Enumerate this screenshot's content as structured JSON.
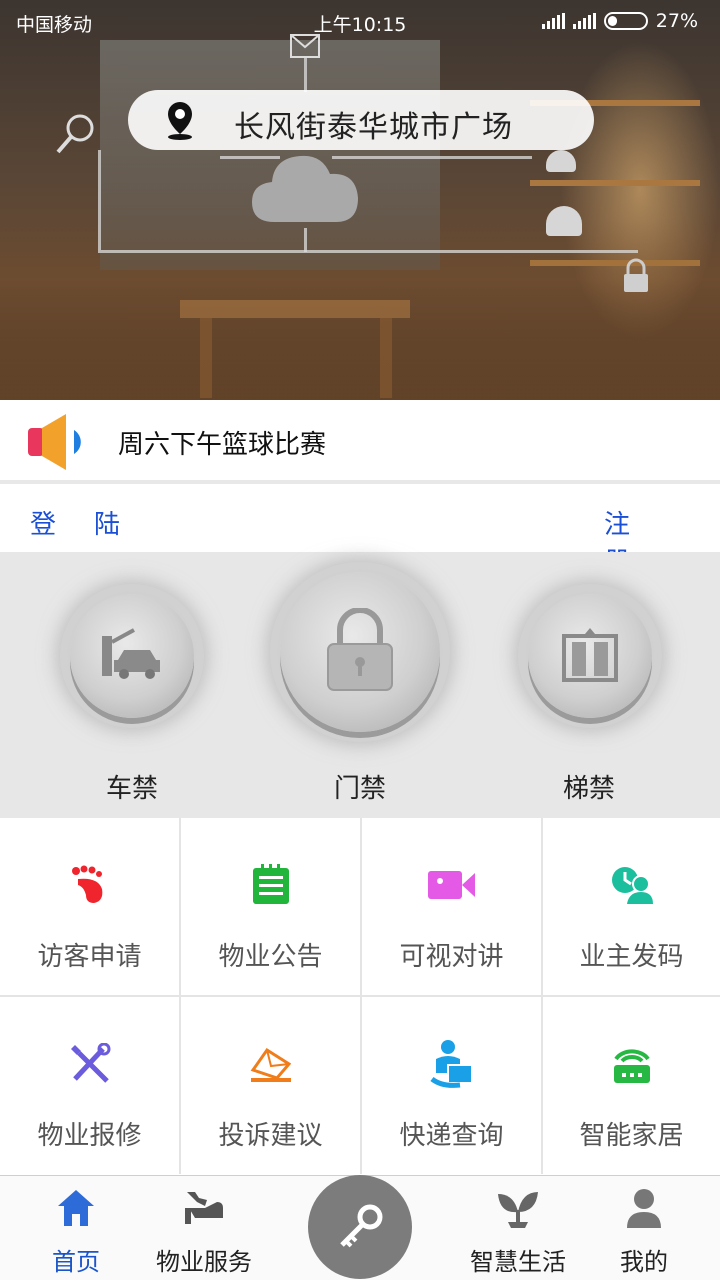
{
  "status_bar": {
    "carrier": "中国移动",
    "time": "上午10:15",
    "battery": "27%",
    "battery_level": 0.27
  },
  "hero": {
    "location": "长风街泰华城市广场"
  },
  "notice": {
    "text": "周六下午篮球比赛"
  },
  "auth": {
    "login": "登陆",
    "register": "注册"
  },
  "access": {
    "items": [
      {
        "label": "车禁",
        "icon": "car-gate-icon"
      },
      {
        "label": "门禁",
        "icon": "lock-icon"
      },
      {
        "label": "梯禁",
        "icon": "elevator-icon"
      }
    ]
  },
  "services": [
    {
      "label": "访客申请",
      "icon": "footprint-icon",
      "color": "#f0242c"
    },
    {
      "label": "物业公告",
      "icon": "notepad-icon",
      "color": "#22b53b"
    },
    {
      "label": "可视对讲",
      "icon": "video-camera-icon",
      "color": "#e45ae6"
    },
    {
      "label": "业主发码",
      "icon": "user-clock-icon",
      "color": "#1bbf9d"
    },
    {
      "label": "物业报修",
      "icon": "tools-icon",
      "color": "#6a5cdc"
    },
    {
      "label": "投诉建议",
      "icon": "envelope-icon",
      "color": "#f07d1a"
    },
    {
      "label": "快递查询",
      "icon": "courier-icon",
      "color": "#1aa0e6"
    },
    {
      "label": "智能家居",
      "icon": "router-icon",
      "color": "#26b842"
    }
  ],
  "nav": {
    "items": [
      {
        "label": "首页",
        "icon": "home-icon",
        "active": true
      },
      {
        "label": "物业服务",
        "icon": "service-icon",
        "active": false
      },
      {
        "label": "",
        "icon": "key-icon",
        "active": false
      },
      {
        "label": "智慧生活",
        "icon": "plant-icon",
        "active": false
      },
      {
        "label": "我的",
        "icon": "profile-icon",
        "active": false
      }
    ],
    "accent": "#1a55c9"
  }
}
